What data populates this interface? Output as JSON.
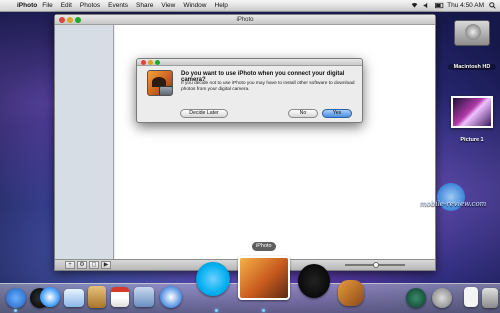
{
  "menubar": {
    "apple_glyph": "",
    "app": "iPhoto",
    "items": [
      "File",
      "Edit",
      "Photos",
      "Events",
      "Share",
      "View",
      "Window",
      "Help"
    ],
    "clock": "Thu 4:50 AM"
  },
  "window": {
    "title": "iPhoto",
    "bottom_buttons": [
      "+",
      "⚙",
      "◻",
      "▶"
    ]
  },
  "dialog": {
    "title": "Do you want to use iPhoto when you connect your digital camera?",
    "body": "If you decide not to use iPhoto you may have to install other software to download photos from your digital camera.",
    "buttons": {
      "decide_later": "Decide Later",
      "no": "No",
      "yes": "Yes"
    }
  },
  "desktop": {
    "hd_label": "Macintosh HD",
    "picture_label": "Picture 1"
  },
  "dock": {
    "tooltip": "iPhoto",
    "items": [
      "Finder",
      "Dashboard",
      "Safari",
      "Mail",
      "Address Book",
      "iCal",
      "Preview",
      "iTunes",
      "Skype",
      "iPhoto",
      "iMovie",
      "GarageBand",
      "Time Machine",
      "System Preferences",
      "Documents",
      "Trash"
    ]
  },
  "watermark": "mobile-review.com",
  "colors": {
    "accent_blue": "#4a8fe0",
    "traffic_red": "#e0443e",
    "traffic_yellow": "#dea123",
    "traffic_green": "#1aab29"
  }
}
